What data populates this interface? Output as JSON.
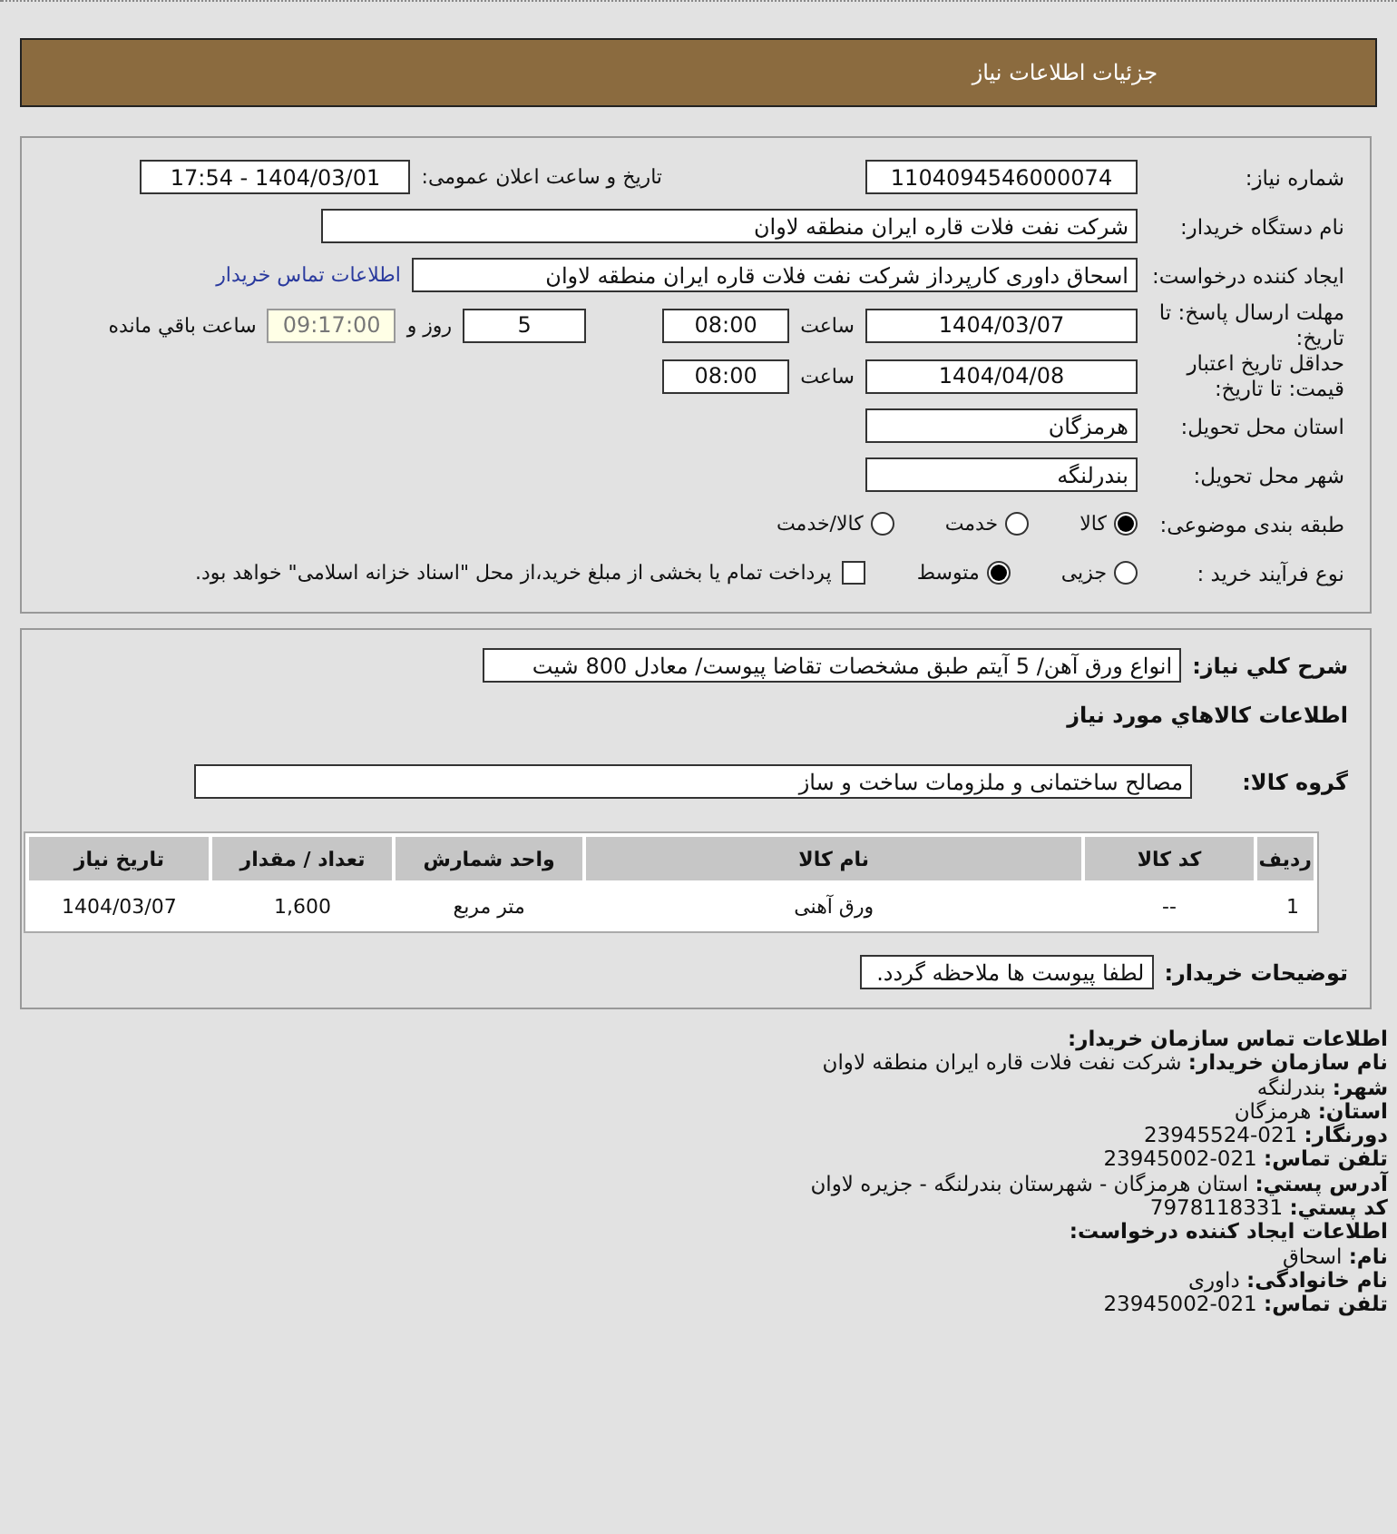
{
  "header": {
    "title": "جزئیات اطلاعات نیاز"
  },
  "details": {
    "need_number": {
      "label": "شماره نیاز:",
      "value": "1104094546000074"
    },
    "announce": {
      "label": "تاریخ و ساعت اعلان عمومی:",
      "value": "1404/03/01 - 17:54"
    },
    "buyer": {
      "label": "نام دستگاه خریدار:",
      "value": "شرکت نفت فلات قاره ایران منطقه لاوان"
    },
    "creator": {
      "label": "ایجاد کننده درخواست:",
      "value": "اسحاق داوری کارپرداز شرکت نفت فلات قاره ایران منطقه لاوان",
      "link": "اطلاعات تماس خریدار"
    },
    "deadline": {
      "label": "مهلت ارسال پاسخ: تا تاریخ:",
      "date": "1404/03/07",
      "time_label": "ساعت",
      "time": "08:00",
      "days": "5",
      "days_label": "روز و",
      "remaining": "09:17:00",
      "remaining_label": "ساعت باقي مانده"
    },
    "validity": {
      "label": "حداقل تاریخ اعتبار قیمت: تا تاریخ:",
      "date": "1404/04/08",
      "time_label": "ساعت",
      "time": "08:00"
    },
    "province": {
      "label": "استان محل تحویل:",
      "value": "هرمزگان"
    },
    "city": {
      "label": "شهر محل تحویل:",
      "value": "بندرلنگه"
    },
    "category": {
      "label": "طبقه بندی موضوعی:",
      "options": [
        {
          "label": "کالا",
          "selected": true
        },
        {
          "label": "خدمت",
          "selected": false
        },
        {
          "label": "کالا/خدمت",
          "selected": false
        }
      ]
    },
    "process": {
      "label": "نوع فرآیند خرید :",
      "options": [
        {
          "label": "جزیی",
          "selected": false
        },
        {
          "label": "متوسط",
          "selected": true
        }
      ],
      "payment": {
        "label": "پرداخت تمام یا بخشی از مبلغ خرید،از محل \"اسناد خزانه اسلامی\" خواهد بود.",
        "checked": false
      }
    }
  },
  "needs": {
    "summary": {
      "label": "شرح کلي نیاز:",
      "value": "انواع ورق آهن/ 5 آیتم طبق مشخصات تقاضا پیوست/ معادل 800 شیت"
    },
    "goods_heading": "اطلاعات کالاهاي مورد نیاز",
    "group": {
      "label": "گروه کالا:",
      "value": "مصالح ساختمانی و ملزومات ساخت  و ساز"
    },
    "table": {
      "columns": [
        "ردیف",
        "کد کالا",
        "نام کالا",
        "واحد شمارش",
        "تعداد / مقدار",
        "تاریخ نیاز"
      ],
      "rows": [
        [
          "1",
          "--",
          "ورق آهنی",
          "متر مربع",
          "1,600",
          "1404/03/07"
        ]
      ]
    },
    "notes": {
      "label": "توضیحات خریدار:",
      "value": "لطفا پیوست ها ملاحظه گردد."
    }
  },
  "contact": [
    {
      "kind": "heading",
      "text": "اطلاعات تماس سازمان خریدار:"
    },
    {
      "kind": "line",
      "text": "**نام سازمان خریدار:** شرکت نفت فلات قاره ایران منطقه لاوان"
    },
    {
      "kind": "line",
      "text": "**شهر:** بندرلنگه"
    },
    {
      "kind": "line",
      "text": "**استان:** هرمزگان"
    },
    {
      "kind": "line",
      "text": "**دورنگار:** 021-23945524"
    },
    {
      "kind": "line",
      "text": "**تلفن تماس:** 021-23945002"
    },
    {
      "kind": "line",
      "text": "**آدرس پستي:** استان هرمزگان - شهرستان بندرلنگه - جزیره لاوان"
    },
    {
      "kind": "line",
      "text": "**کد پستي:** 7978118331"
    },
    {
      "kind": "heading",
      "text": "اطلاعات ایجاد کننده درخواست:"
    },
    {
      "kind": "line",
      "text": "**نام:** اسحاق"
    },
    {
      "kind": "line",
      "text": "**نام خانوادگی:** داوری"
    },
    {
      "kind": "line",
      "text": "**تلفن تماس:** 021-23945002"
    }
  ]
}
